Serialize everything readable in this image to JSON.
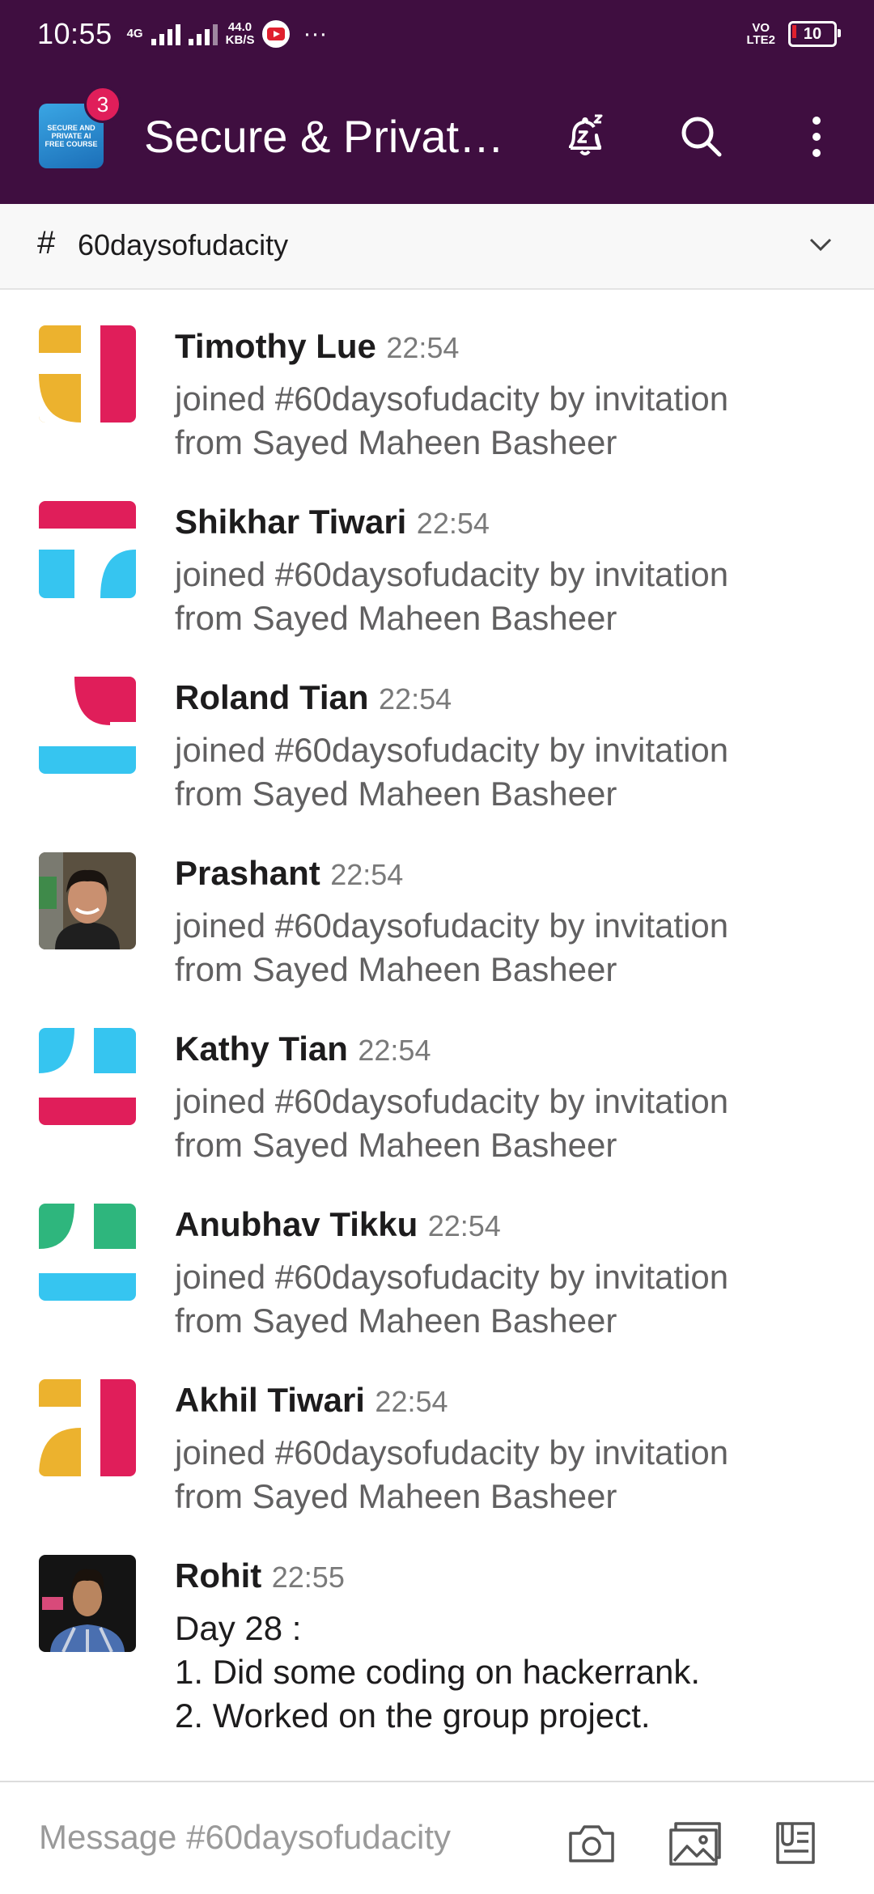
{
  "status_bar": {
    "time": "10:55",
    "network_1": "4G",
    "speed_value": "44.0",
    "speed_unit": "KB/S",
    "more": "···",
    "volte_top": "VO",
    "volte_bottom": "LTE2",
    "battery": "10"
  },
  "app_bar": {
    "workspace_icon_text": "SECURE AND PRIVATE AI FREE COURSE",
    "badge_count": "3",
    "workspace_title": "Secure & Privat…"
  },
  "channel": {
    "hash": "#",
    "name": "60daysofudacity"
  },
  "messages": [
    {
      "name": "Timothy Lue",
      "time": "22:54",
      "lines": [
        "joined #60daysofudacity by invitation",
        "from Sayed Maheen Basheer"
      ]
    },
    {
      "name": "Shikhar Tiwari",
      "time": "22:54",
      "lines": [
        "joined #60daysofudacity by invitation",
        "from Sayed Maheen Basheer"
      ]
    },
    {
      "name": "Roland Tian",
      "time": "22:54",
      "lines": [
        "joined #60daysofudacity by invitation",
        "from Sayed Maheen Basheer"
      ]
    },
    {
      "name": "Prashant",
      "time": "22:54",
      "lines": [
        "joined #60daysofudacity by invitation",
        "from Sayed Maheen Basheer"
      ]
    },
    {
      "name": "Kathy Tian",
      "time": "22:54",
      "lines": [
        "joined #60daysofudacity by invitation",
        "from Sayed Maheen Basheer"
      ]
    },
    {
      "name": "Anubhav Tikku",
      "time": "22:54",
      "lines": [
        "joined #60daysofudacity by invitation",
        "from Sayed Maheen Basheer"
      ]
    },
    {
      "name": "Akhil Tiwari",
      "time": "22:54",
      "lines": [
        "joined #60daysofudacity by invitation",
        "from Sayed Maheen Basheer"
      ]
    },
    {
      "name": "Rohit",
      "time": "22:55",
      "lines": [
        "Day 28 :",
        "1. Did some coding on hackerrank.",
        "2. Worked on the group project."
      ]
    }
  ],
  "composer": {
    "placeholder": "Message #60daysofudacity"
  },
  "colors": {
    "header_bg": "#3f0e40",
    "badge": "#e01e5a",
    "avatar_yellow": "#ecb22e",
    "avatar_red": "#e01e5a",
    "avatar_blue": "#36c5f0",
    "avatar_green": "#2eb67d"
  },
  "icons": [
    "snooze-bell-icon",
    "search-icon",
    "more-vert-icon",
    "chevron-down-icon",
    "camera-icon",
    "image-icon",
    "clipboard-icon"
  ]
}
